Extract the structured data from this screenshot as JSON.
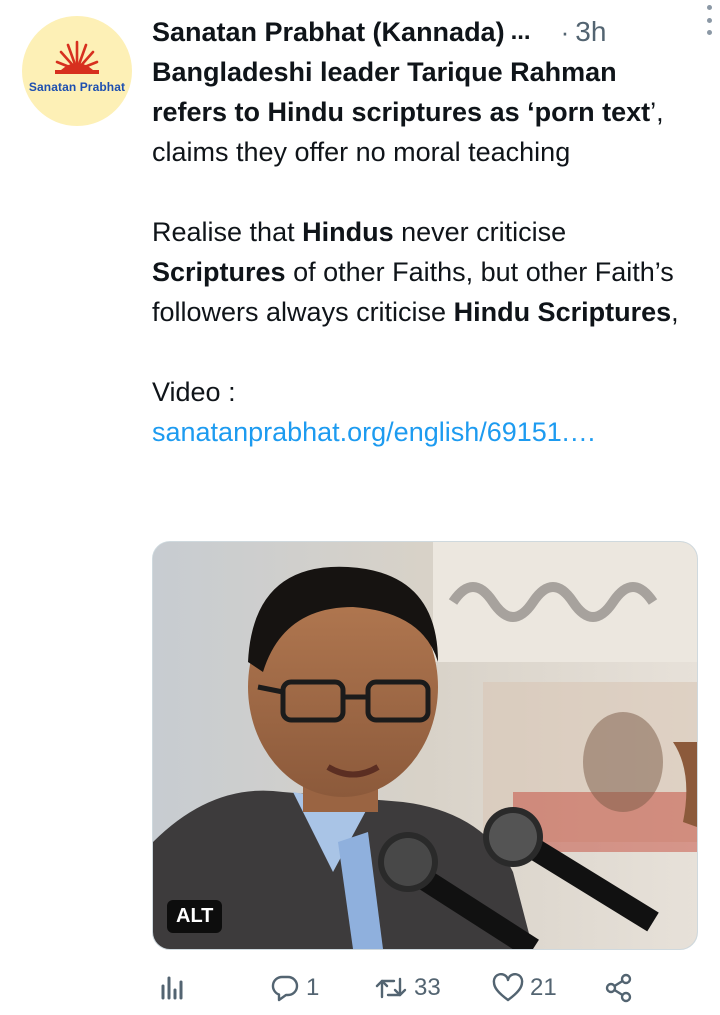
{
  "tweet": {
    "author": "Sanatan Prabhat (Kannada)",
    "author_overflow": "...",
    "separator": "·",
    "time": "3h",
    "avatar_brand": "Sanatan Prabhat",
    "body": {
      "p1_bold": "Bangladeshi leader Tarique Rahman refers to Hindu scriptures as ‘porn text",
      "p1_rest": "’, claims they offer no moral teaching",
      "p2_a": "Realise that ",
      "p2_b": "Hindus",
      "p2_c": " never criticise ",
      "p2_d": "Scriptures",
      "p2_e": " of other Faiths, but other Faith’s followers always criticise ",
      "p2_f": "Hindu Scriptures",
      "p2_g": ",",
      "p3_label": "Video :",
      "p3_link": "sanatanprabhat.org/english/69151.…"
    },
    "media": {
      "alt_label": "ALT"
    },
    "actions": {
      "replies": "1",
      "retweets": "33",
      "likes": "21"
    }
  },
  "colors": {
    "link": "#1d9bf0",
    "secondary_text": "#536471",
    "avatar_bg": "#fdf0b6",
    "brand_red": "#d7301f",
    "brand_blue": "#1d4fb0"
  },
  "icons": [
    "analytics-icon",
    "reply-icon",
    "retweet-icon",
    "like-icon",
    "share-icon",
    "more-icon"
  ]
}
